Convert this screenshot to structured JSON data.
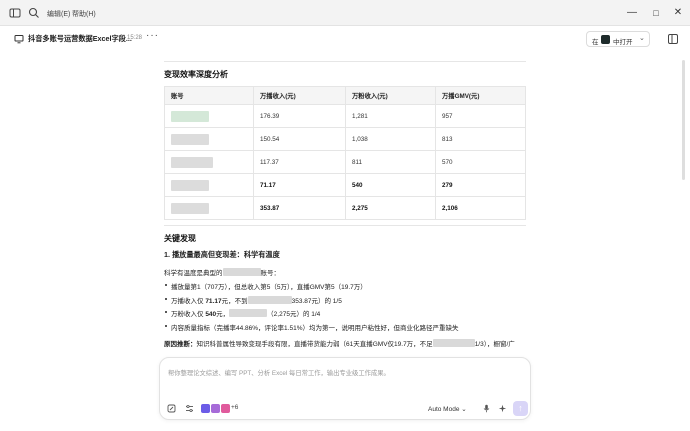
{
  "menu": {
    "edit": "编辑(E)",
    "help": "帮助(H)"
  },
  "header": {
    "title": "抖音多账号运营数据Excel字段...",
    "time": "15:28",
    "more": "···"
  },
  "open_button": {
    "prefix": "在",
    "label": "中打开"
  },
  "section1": {
    "title": "变现效率深度分析"
  },
  "table": {
    "headers": [
      "账号",
      "万播收入(元)",
      "万粉收入(元)",
      "万播GMV(元)"
    ],
    "rows": [
      {
        "income_per_10k_plays": "176.39",
        "income_per_10k_fans": "1,281",
        "gmv_per_10k_plays": "957",
        "bold": false
      },
      {
        "income_per_10k_plays": "150.54",
        "income_per_10k_fans": "1,038",
        "gmv_per_10k_plays": "813",
        "bold": false
      },
      {
        "income_per_10k_plays": "117.37",
        "income_per_10k_fans": "811",
        "gmv_per_10k_plays": "570",
        "bold": false
      },
      {
        "income_per_10k_plays": "71.17",
        "income_per_10k_fans": "540",
        "gmv_per_10k_plays": "279",
        "bold": true
      },
      {
        "income_per_10k_plays": "353.87",
        "income_per_10k_fans": "2,275",
        "gmv_per_10k_plays": "2,106",
        "bold": true
      }
    ]
  },
  "section2": {
    "title": "关键发现",
    "subtitle": "1. 播放量最高但变现差：科学有温度",
    "intro_a": "科学有温度是典型的",
    "intro_b": "账号：",
    "bullets": {
      "b1": "播放量第1（707万），但总收入第5（5万），直播GMV第5（19.7万）",
      "b2a": "万播收入仅 ",
      "b2v": "71.17",
      "b2b": "元，不到",
      "b2c": "353.87元）的 1/5",
      "b3a": "万粉收入仅 ",
      "b3v": "540",
      "b3b": "元，",
      "b3c": "（2,275元）的 1/4",
      "b4": "内容质量指标（完播率44.86%，评论率1.51%）均为第一，说明用户粘性好，但商业化路径严重缺失"
    },
    "reason_label": "原因推断：",
    "reason_text": "知识科普属性导致变现手段有限，直播带货能力弱（61天直播GMV仅19.7万，不足",
    "reason_tail": "1/3），橱窗/广"
  },
  "input": {
    "placeholder": "帮你整理论文综述、编写 PPT、分析 Excel 每日常工作，输出专业级工作成果。",
    "plus_count": "+6",
    "mode": "Auto Mode",
    "mode_chevron": "⌄"
  },
  "colors": {
    "accent": "#6c5ce7",
    "send_disabled": "#d9d5f7"
  }
}
